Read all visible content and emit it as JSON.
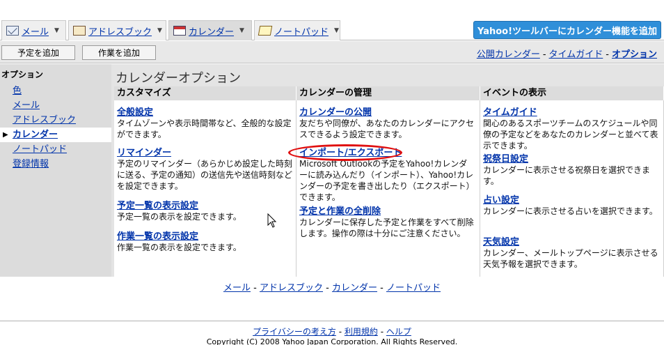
{
  "tabs": [
    {
      "label": "メール",
      "icon": "mail-icon"
    },
    {
      "label": "アドレスブック",
      "icon": "addressbook-icon"
    },
    {
      "label": "カレンダー",
      "icon": "calendar-icon"
    },
    {
      "label": "ノートパッド",
      "icon": "notepad-icon"
    }
  ],
  "toolbar_button": "Yahoo!ツールバーにカレンダー機能を追加",
  "actions": {
    "add_event": "予定を追加",
    "add_task": "作業を追加"
  },
  "toplinks": {
    "public_calendar": "公開カレンダー",
    "time_guide": "タイムガイド",
    "options": "オプション",
    "sep": "-"
  },
  "sidebar": {
    "heading": "オプション",
    "items": [
      {
        "label": "色"
      },
      {
        "label": "メール"
      },
      {
        "label": "アドレスブック"
      },
      {
        "label": "カレンダー"
      },
      {
        "label": "ノートパッド"
      },
      {
        "label": "登録情報"
      }
    ]
  },
  "page_title": "カレンダーオプション",
  "columns": [
    {
      "heading": "カスタマイズ",
      "entries": [
        {
          "title": "全般設定",
          "desc": "タイムゾーンや表示時間帯など、全般的な設定ができます。"
        },
        {
          "title": "リマインダー",
          "desc": "予定のリマインダー（あらかじめ設定した時刻に送る、予定の通知）の送信先や送信時刻などを設定できます。"
        },
        {
          "title": "予定一覧の表示設定",
          "desc": "予定一覧の表示を設定できます。"
        },
        {
          "title": "作業一覧の表示設定",
          "desc": "作業一覧の表示を設定できます。"
        }
      ]
    },
    {
      "heading": "カレンダーの管理",
      "entries": [
        {
          "title": "カレンダーの公開",
          "desc": "友だちや同僚が、あなたのカレンダーにアクセスできるよう設定できます。"
        },
        {
          "title": "インポート/エクスポート",
          "desc": "Microsoft Outlookの予定をYahoo!カレンダーに読み込んだり（インポート）、Yahoo!カレンダーの予定を書き出したり（エクスポート）できます。"
        },
        {
          "title": "予定と作業の全削除",
          "desc": "カレンダーに保存した予定と作業をすべて削除します。操作の際は十分にご注意ください。"
        }
      ]
    },
    {
      "heading": "イベントの表示",
      "entries": [
        {
          "title": "タイムガイド",
          "desc": "関心のあるスポーツチームのスケジュールや同僚の予定などをあなたのカレンダーと並べて表示できます。"
        },
        {
          "title": "祝祭日設定",
          "desc": "カレンダーに表示させる祝祭日を選択できます。"
        },
        {
          "title": "占い設定",
          "desc": "カレンダーに表示させる占いを選択できます。"
        },
        {
          "title": "天気設定",
          "desc": "カレンダー、メールトップページに表示させる天気予報を選択できます。"
        }
      ]
    }
  ],
  "bottom_nav": [
    "メール",
    "アドレスブック",
    "カレンダー",
    "ノートパッド"
  ],
  "footer": {
    "privacy": "プライバシーの考え方",
    "terms": "利用規約",
    "help": "ヘルプ",
    "copyright": "Copyright (C) 2008 Yahoo Japan Corporation. All Rights Reserved."
  },
  "colors": {
    "accent_button": "#2f8fd9",
    "link": "#0033aa",
    "highlight_ellipse": "#e01010"
  }
}
